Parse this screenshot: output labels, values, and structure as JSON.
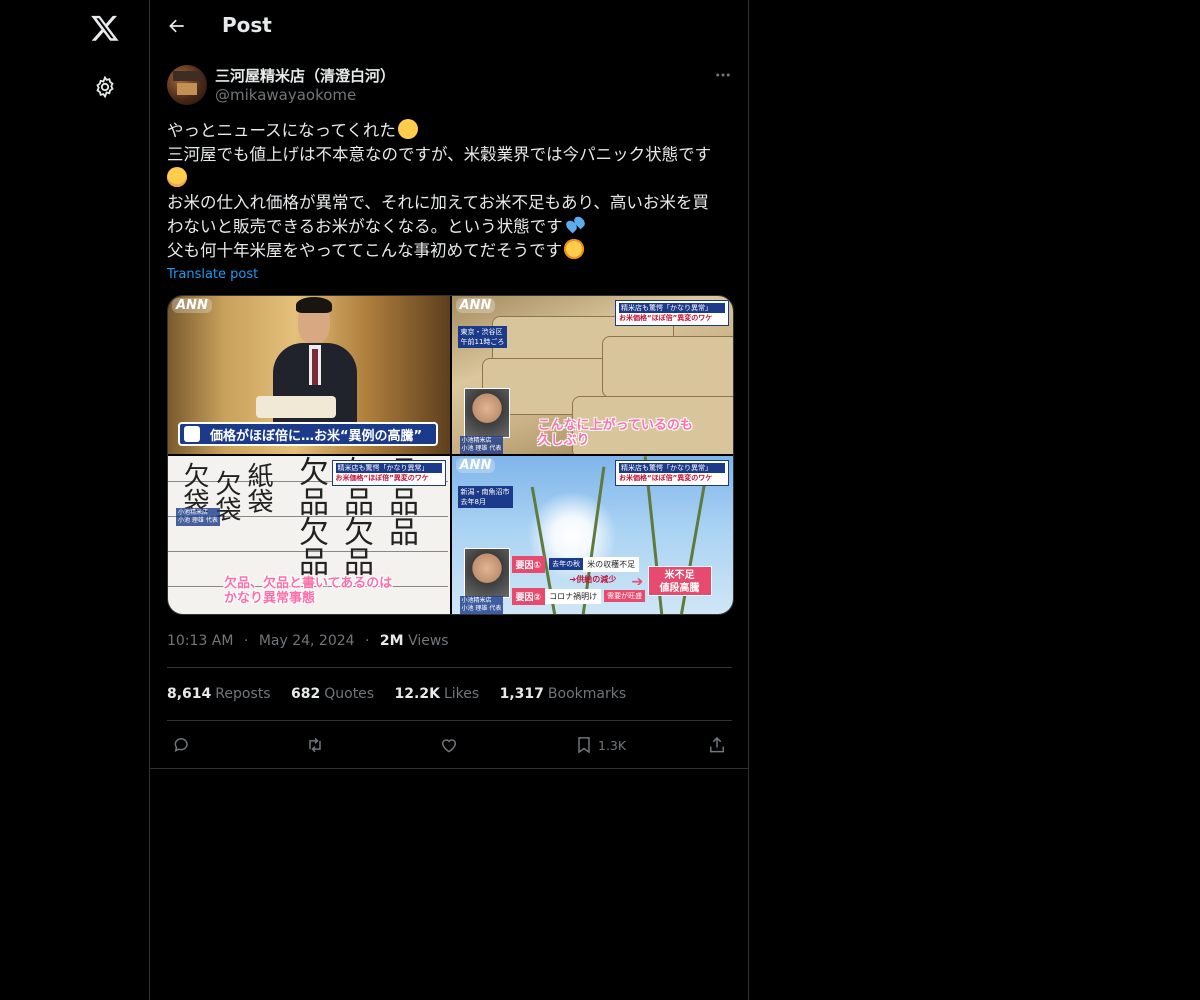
{
  "nav": {
    "logo_icon": "x-logo-icon",
    "settings_icon": "gear-icon"
  },
  "header": {
    "back_icon": "arrow-left-icon",
    "title": "Post"
  },
  "author": {
    "display_name": "三河屋精米店（清澄白河）",
    "handle": "@mikawayaokome",
    "more_icon": "more-dots-icon"
  },
  "post": {
    "lines": [
      "やっとニュースになってくれた",
      "三河屋でも値上げは不本意なのですが、米穀業界では今パニック状態です",
      "お米の仕入れ価格が異常で、それに加えてお米不足もあり、高いお米を買",
      "わないと販売できるお米がなくなる。という状態です",
      "父も何十年米屋をやっててこんな事初めてだそうです"
    ],
    "emojis": [
      "smiling-face-with-tear",
      "sweat-face",
      "sweat-droplets",
      "tired-face"
    ],
    "translate_label": "Translate post"
  },
  "media": {
    "image1": {
      "logo": "ANN",
      "caption": "価格がほぼ倍に…お米“異例の高騰”"
    },
    "image2": {
      "logo": "ANN",
      "tag_top": "精米店も驚愕「かなり異常」",
      "tag_main": "お米価格“ほぼ倍”異変のワケ",
      "loc1": "東京・渋谷区",
      "loc2": "午前11時ごろ",
      "name1": "小池精米店",
      "name2": "小池 理雄 代表",
      "subtitle1": "こんなに上がっているのも",
      "subtitle2": "久しぶり"
    },
    "image3": {
      "tag_top": "精米店も驚愕「かなり異常」",
      "tag_main": "お米価格“ほぼ倍”異変のワケ",
      "name1": "小池精米店",
      "name2": "小池 理雄 代表",
      "subtitle1": "欠品、欠品と書いてあるのは",
      "subtitle2": "かなり異常事態"
    },
    "image4": {
      "logo": "ANN",
      "tag_top": "精米店も驚愕「かなり異常」",
      "tag_main": "お米価格“ほぼ倍”異変のワケ",
      "loc1": "新潟・南魚沼市",
      "loc2": "去年8月",
      "name1": "小池精米店",
      "name2": "小池 理雄 代表",
      "factor1_label": "要因①",
      "factor1_when": "去年の秋",
      "factor1_text": "米の収穫不足",
      "factor1_arrow": "➔供給の減少",
      "factor2_label": "要因②",
      "factor2_text": "コロナ禍明け",
      "factor2_tag": "需要が旺盛",
      "result1": "米不足",
      "result2": "値段高騰"
    }
  },
  "meta": {
    "time": "10:13 AM",
    "sep": "·",
    "date": "May 24, 2024",
    "views_value": "2M",
    "views_label": "Views"
  },
  "stats": [
    {
      "value": "8,614",
      "label": "Reposts"
    },
    {
      "value": "682",
      "label": "Quotes"
    },
    {
      "value": "12.2K",
      "label": "Likes"
    },
    {
      "value": "1,317",
      "label": "Bookmarks"
    }
  ],
  "actions": {
    "reply_icon": "reply-icon",
    "repost_icon": "repost-icon",
    "like_icon": "heart-icon",
    "bookmark_icon": "bookmark-icon",
    "bookmark_count": "1.3K",
    "share_icon": "share-icon"
  },
  "colors": {
    "background": "#000000",
    "text": "#e7e9ea",
    "muted": "#71767b",
    "link": "#1d9bf0",
    "border": "#2f3336"
  }
}
